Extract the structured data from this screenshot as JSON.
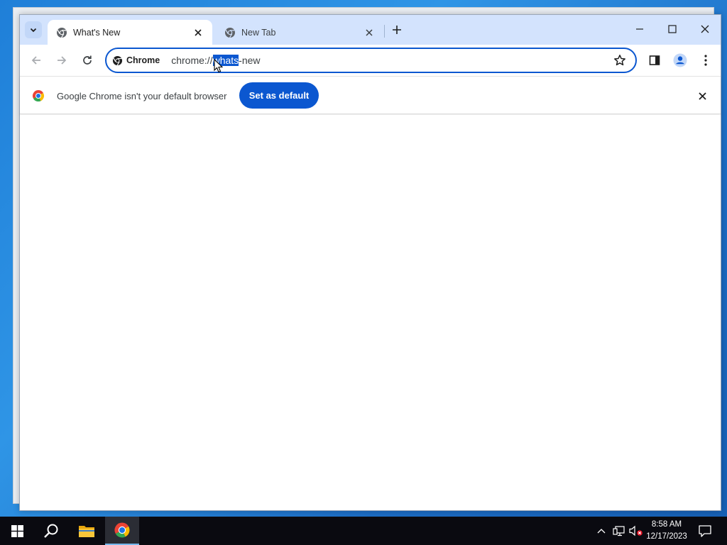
{
  "browser": {
    "tabs": [
      {
        "title": "What's New",
        "active": true
      },
      {
        "title": "New Tab",
        "active": false
      }
    ],
    "omnibox": {
      "chip_label": "Chrome",
      "url_before": "chrome://",
      "url_selected": "whats",
      "url_after": "-new"
    }
  },
  "infobar": {
    "message": "Google Chrome isn't your default browser",
    "button_label": "Set as default"
  },
  "taskbar": {
    "time": "8:58 AM",
    "date": "12/17/2023"
  },
  "colors": {
    "accent": "#0b57d0",
    "tabstrip": "#d3e3fd",
    "taskbar": "#0a0a10"
  },
  "icons": [
    "tab-search-icon",
    "chrome-favicon",
    "close-icon",
    "plus-icon",
    "minimize-icon",
    "maximize-icon",
    "back-arrow-icon",
    "forward-arrow-icon",
    "reload-icon",
    "star-icon",
    "side-panel-icon",
    "profile-icon",
    "kebab-menu-icon",
    "windows-start-icon",
    "search-icon",
    "folder-icon",
    "chrome-logo-icon",
    "chevron-up-icon",
    "network-icon",
    "volume-muted-icon",
    "notification-icon"
  ]
}
